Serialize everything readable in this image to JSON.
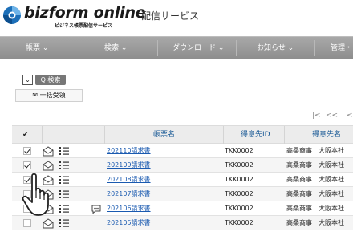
{
  "header": {
    "logo_text": "bizform online",
    "logo_sub": "ビジネス帳票配信サービス",
    "app_title": "配信サービス"
  },
  "nav": {
    "items": [
      {
        "label": "帳票 ⌄"
      },
      {
        "label": "検索 ⌄"
      },
      {
        "label": "ダウンロード ⌄"
      },
      {
        "label": "お知らせ ⌄"
      },
      {
        "label": "管理・"
      }
    ]
  },
  "search": {
    "dropdown_label": "⌄",
    "search_button": "Q 検索",
    "bulk_receive_button": "✉ 一括受領"
  },
  "pager": {
    "first": "|<",
    "prev": "<<",
    "back": "<"
  },
  "table": {
    "columns": {
      "check": "✔",
      "doc_name": "帳票名",
      "client_id": "得意先ID",
      "client_name": "得意先名"
    },
    "rows": [
      {
        "checked": true,
        "has_comment": false,
        "doc_name": "202110請求書",
        "client_id": "TKK0002",
        "client_name": "高桑商事　大阪本社"
      },
      {
        "checked": true,
        "has_comment": false,
        "doc_name": "202109請求書",
        "client_id": "TKK0002",
        "client_name": "高桑商事　大阪本社"
      },
      {
        "checked": true,
        "has_comment": false,
        "doc_name": "202108請求書",
        "client_id": "TKK0002",
        "client_name": "高桑商事　大阪本社"
      },
      {
        "checked": false,
        "has_comment": false,
        "doc_name": "202107請求書",
        "client_id": "TKK0002",
        "client_name": "高桑商事　大阪本社"
      },
      {
        "checked": false,
        "has_comment": true,
        "doc_name": "202106請求書",
        "client_id": "TKK0002",
        "client_name": "高桑商事　大阪本社"
      },
      {
        "checked": false,
        "has_comment": false,
        "doc_name": "202105請求書",
        "client_id": "TKK0002",
        "client_name": "高桑商事　大阪本社"
      }
    ]
  },
  "colors": {
    "nav_bg": "#999999",
    "link": "#1a5ab0",
    "header_text": "#1a5a96",
    "logo_blue": "#1c6fb8"
  }
}
